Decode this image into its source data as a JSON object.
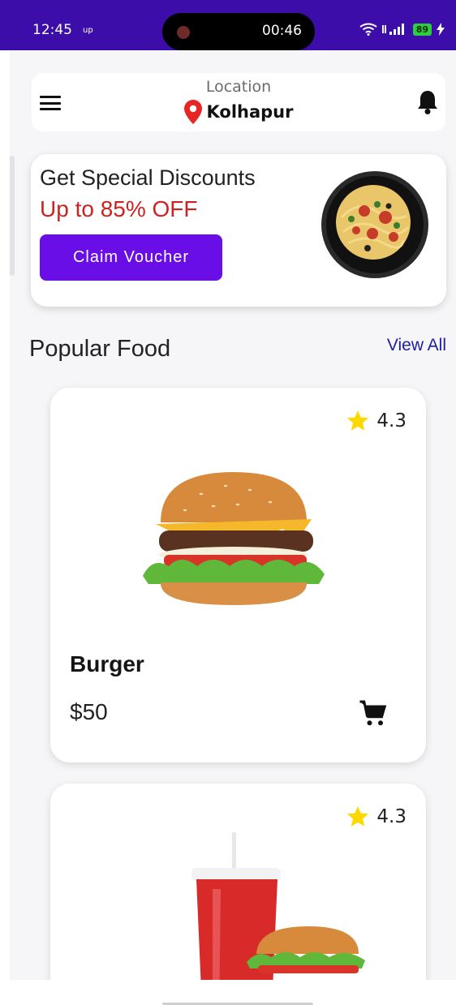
{
  "status_bar": {
    "time": "12:45",
    "data_indicator": "up",
    "call_timer": "00:46",
    "battery": "89"
  },
  "header": {
    "location_label": "Location",
    "city": "Kolhapur"
  },
  "promo": {
    "title": "Get Special Discounts",
    "subtitle": "Up to 85% OFF",
    "button_label": "Claim Voucher"
  },
  "section": {
    "title": "Popular Food",
    "view_all": "View All"
  },
  "foods": [
    {
      "name": "Burger",
      "price": "$50",
      "rating": "4.3"
    },
    {
      "rating": "4.3"
    }
  ],
  "colors": {
    "status_bar": "#3c0da8",
    "accent": "#6a0ee8",
    "discount": "#cc2222",
    "link": "#1e1e9e",
    "star": "#ffd800"
  }
}
